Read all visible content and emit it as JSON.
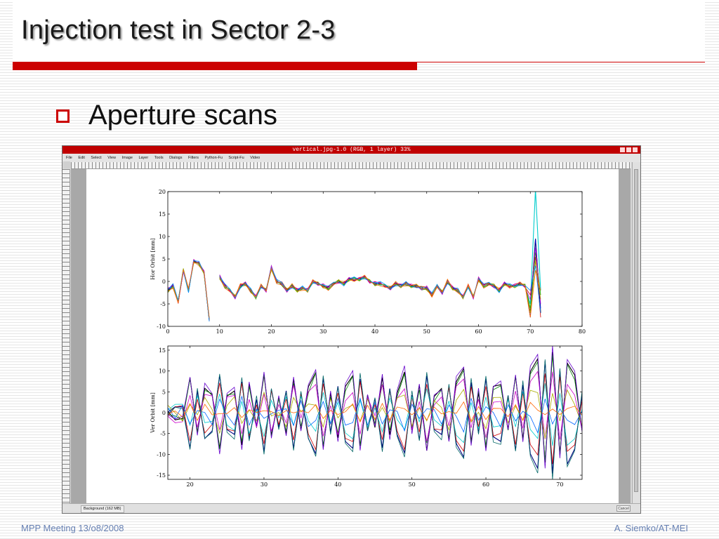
{
  "slide": {
    "title": "Injection test in Sector 2-3",
    "bullet": "Aperture scans",
    "footer_left": "MPP Meeting 13/o8/2008",
    "footer_right": "A. Siemko/AT-MEI"
  },
  "colors": {
    "accent_red": "#cc0000",
    "footer_text": "#6680b3",
    "gimp_title_bar": "#c00000"
  },
  "gimp": {
    "window_title": "vertical.jpg-1.0 (RGB, 1 layer) 33%",
    "menu": [
      "File",
      "Edit",
      "Select",
      "View",
      "Image",
      "Layer",
      "Tools",
      "Dialogs",
      "Filters",
      "Python-Fu",
      "Script-Fu",
      "Video"
    ],
    "status": "Background (162 MB)",
    "cancel": "Cancel"
  },
  "chart_data": [
    {
      "type": "line",
      "title": "",
      "xlabel": "",
      "ylabel": "Hor Orbit [mm]",
      "xlim": [
        0,
        80
      ],
      "ylim": [
        -10,
        20
      ],
      "xticks": [
        0,
        10,
        20,
        30,
        40,
        50,
        60,
        70,
        80
      ],
      "yticks": [
        -10,
        -5,
        0,
        5,
        10,
        15,
        20
      ],
      "x": [
        0,
        1,
        2,
        3,
        4,
        5,
        6,
        7,
        8,
        9,
        10,
        11,
        12,
        13,
        14,
        15,
        16,
        17,
        18,
        19,
        20,
        21,
        22,
        23,
        24,
        25,
        26,
        27,
        28,
        29,
        30,
        31,
        32,
        33,
        34,
        35,
        36,
        37,
        38,
        39,
        40,
        41,
        42,
        43,
        44,
        45,
        46,
        47,
        48,
        49,
        50,
        51,
        52,
        53,
        54,
        55,
        56,
        57,
        58,
        59,
        60,
        61,
        62,
        63,
        64,
        65,
        66,
        67,
        68,
        69,
        70,
        71,
        72
      ],
      "base_values": [
        -2,
        -1,
        -4.5,
        2.5,
        -2,
        4.5,
        4,
        2,
        -8.5,
        null,
        1,
        -1,
        -2,
        -3.5,
        -1,
        -0.5,
        -2,
        -3.5,
        -1,
        -2,
        3,
        0,
        -0.5,
        -2,
        -1,
        -2,
        -1.5,
        -2,
        0,
        -0.5,
        -1,
        -1.5,
        -0.5,
        0,
        -0.5,
        0.5,
        0.5,
        0.5,
        1,
        0,
        -0.5,
        -0.5,
        -1,
        -1.5,
        -0.5,
        -1,
        -0.5,
        -1,
        -1,
        -1.5,
        -1.5,
        -3,
        -1,
        -2.5,
        0,
        -1.5,
        -2,
        -3.5,
        -1,
        -3.5,
        0.5,
        -1,
        -0.5,
        -1,
        -2,
        -0.5,
        -1,
        -1,
        -0.5,
        -1,
        -1,
        0.5,
        0
      ],
      "series": [
        {
          "offsets": [
            0,
            0,
            0,
            0,
            0,
            0,
            0,
            0,
            0,
            0,
            0,
            0,
            0,
            0,
            0,
            0,
            0,
            0,
            0,
            0,
            0,
            0,
            0,
            0,
            0,
            0,
            0,
            0,
            0,
            0,
            0,
            0,
            0,
            0,
            0,
            0,
            0,
            0,
            0,
            0,
            0,
            0,
            0,
            0,
            0,
            0,
            0,
            0,
            0,
            0,
            0,
            0,
            0,
            0,
            0,
            0,
            0,
            0,
            0,
            0,
            0,
            0,
            0,
            0,
            0,
            0,
            0,
            0,
            0,
            0,
            -6,
            9,
            -7
          ],
          "color": "#000000"
        },
        {
          "offsets": [
            0.4,
            -0.3,
            0.2,
            0.3,
            -0.2,
            0.3,
            -0.2,
            0.2,
            0.3,
            0,
            0.4,
            -0.3,
            0.3,
            -0.3,
            0.2,
            -0.3,
            0.3,
            -0.4,
            0.3,
            -0.2,
            0.4,
            -0.3,
            0.2,
            -0.3,
            0.3,
            -0.3,
            0.3,
            -0.2,
            0.3,
            -0.3,
            0.2,
            -0.3,
            0.3,
            -0.2,
            0.3,
            -0.2,
            0.3,
            -0.3,
            0.2,
            -0.3,
            0.3,
            -0.3,
            0.2,
            -0.3,
            0.3,
            -0.2,
            0.3,
            -0.3,
            0.2,
            -0.3,
            0.3,
            -0.2,
            0.3,
            -0.3,
            0.2,
            -0.3,
            0.3,
            -0.3,
            0.2,
            -0.3,
            0.3,
            -0.2,
            0.3,
            -0.3,
            0.2,
            -0.3,
            0.3,
            -0.2,
            0.3,
            -0.3,
            -4,
            20,
            -2
          ],
          "color": "#00cccc"
        },
        {
          "offsets": [
            -0.4,
            0.3,
            -0.3,
            -0.3,
            0.3,
            -0.2,
            0.3,
            -0.3,
            -0.2,
            0,
            -0.4,
            0.3,
            -0.3,
            0.3,
            -0.2,
            0.3,
            -0.3,
            0.4,
            -0.3,
            0.3,
            -0.3,
            0.3,
            -0.3,
            0.3,
            -0.3,
            0.3,
            -0.2,
            0.3,
            -0.3,
            0.3,
            -0.2,
            0.3,
            -0.3,
            0.3,
            -0.2,
            0.3,
            -0.3,
            0.3,
            -0.2,
            0.3,
            -0.3,
            0.3,
            -0.3,
            0.2,
            -0.3,
            0.3,
            -0.3,
            0.2,
            -0.3,
            0.3,
            -0.3,
            0.2,
            -0.3,
            0.3,
            -0.3,
            0.2,
            -0.3,
            0.3,
            -0.3,
            0.2,
            -0.3,
            0.3,
            -0.3,
            0.2,
            -0.3,
            0.3,
            -0.3,
            0.2,
            -0.3,
            0.3,
            -7,
            9,
            -6
          ],
          "color": "#0000cc"
        },
        {
          "offsets": [
            0.2,
            0.4,
            -0.4,
            0.2,
            0.4,
            -0.3,
            0.2,
            0.3,
            -0.3,
            0,
            0.2,
            0.4,
            -0.3,
            0.2,
            0.4,
            -0.3,
            0.2,
            0.3,
            -0.4,
            0.2,
            0.3,
            -0.3,
            0.4,
            0.2,
            -0.3,
            0.3,
            0.2,
            -0.4,
            0.3,
            0.2,
            -0.3,
            0.4,
            0.2,
            -0.3,
            0.3,
            0.2,
            -0.4,
            0.3,
            0.2,
            -0.3,
            0.4,
            0.2,
            -0.3,
            0.3,
            0.2,
            -0.4,
            0.3,
            0.2,
            -0.3,
            0.4,
            0.2,
            -0.3,
            0.3,
            0.2,
            -0.4,
            0.3,
            0.2,
            -0.3,
            0.4,
            0.2,
            -0.3,
            0.3,
            0.2,
            -0.4,
            0.3,
            0.2,
            -0.3,
            0.4,
            0.2,
            -0.3,
            -2,
            5,
            -8
          ],
          "color": "#cc0000"
        },
        {
          "offsets": [
            -0.2,
            -0.4,
            0.4,
            -0.2,
            -0.4,
            0.3,
            -0.2,
            -0.3,
            0.3,
            0,
            -0.2,
            -0.4,
            0.3,
            -0.2,
            -0.4,
            0.3,
            -0.2,
            -0.3,
            0.4,
            -0.2,
            -0.3,
            0.3,
            -0.4,
            -0.2,
            0.3,
            -0.3,
            -0.2,
            0.4,
            -0.3,
            -0.2,
            0.3,
            -0.4,
            -0.2,
            0.3,
            -0.3,
            -0.2,
            0.4,
            -0.3,
            -0.2,
            0.3,
            -0.4,
            -0.2,
            0.3,
            -0.3,
            -0.2,
            0.4,
            -0.3,
            -0.2,
            0.3,
            -0.4,
            -0.2,
            0.3,
            -0.3,
            -0.2,
            0.4,
            -0.3,
            -0.2,
            0.3,
            -0.4,
            -0.2,
            0.3,
            -0.3,
            -0.2,
            0.4,
            -0.3,
            -0.2,
            0.3,
            -0.4,
            -0.2,
            0.3,
            -5,
            6,
            -3
          ],
          "color": "#00aa00"
        },
        {
          "offsets": [
            0.5,
            0.1,
            -0.1,
            -0.4,
            0.1,
            0.4,
            -0.1,
            0.4,
            0.1,
            0,
            0.5,
            0.1,
            -0.1,
            -0.4,
            0.1,
            0.4,
            -0.1,
            0.4,
            0.1,
            -0.4,
            0.5,
            0.1,
            -0.1,
            -0.4,
            0.1,
            0.4,
            -0.1,
            0.4,
            0.1,
            -0.4,
            0.5,
            0.1,
            -0.1,
            -0.4,
            0.1,
            0.4,
            -0.1,
            0.4,
            0.1,
            -0.4,
            0.5,
            0.1,
            -0.1,
            -0.4,
            0.1,
            0.4,
            -0.1,
            0.4,
            0.1,
            -0.4,
            0.5,
            0.1,
            -0.1,
            -0.4,
            0.1,
            0.4,
            -0.1,
            0.4,
            0.1,
            -0.4,
            0.5,
            0.1,
            -0.1,
            -0.4,
            0.1,
            0.4,
            -0.1,
            0.4,
            0.1,
            -0.4,
            -3,
            7,
            -5
          ],
          "color": "#cc00cc"
        },
        {
          "offsets": [
            -0.5,
            -0.1,
            0.1,
            0.4,
            -0.1,
            -0.4,
            0.1,
            -0.4,
            -0.1,
            0,
            -0.5,
            -0.1,
            0.1,
            0.4,
            -0.1,
            -0.4,
            0.1,
            -0.4,
            -0.1,
            0.4,
            -0.5,
            -0.1,
            0.1,
            0.4,
            -0.1,
            -0.4,
            0.1,
            -0.4,
            -0.1,
            0.4,
            -0.5,
            -0.1,
            0.1,
            0.4,
            -0.1,
            -0.4,
            0.1,
            -0.4,
            -0.1,
            0.4,
            -0.5,
            -0.1,
            0.1,
            0.4,
            -0.1,
            -0.4,
            0.1,
            -0.4,
            -0.1,
            0.4,
            -0.5,
            -0.1,
            0.1,
            0.4,
            -0.1,
            -0.4,
            0.1,
            -0.4,
            -0.1,
            0.4,
            -0.5,
            -0.1,
            0.1,
            0.4,
            -0.1,
            -0.4,
            0.1,
            -0.4,
            -0.1,
            0.4,
            -6,
            4,
            -4
          ],
          "color": "#aaaa00"
        },
        {
          "offsets": [
            0.1,
            0.5,
            0.3,
            -0.1,
            -0.5,
            0.1,
            0.5,
            -0.1,
            -0.4,
            0,
            0.1,
            0.5,
            0.3,
            -0.1,
            -0.5,
            0.1,
            0.5,
            -0.1,
            -0.4,
            0.1,
            0.1,
            0.5,
            0.3,
            -0.1,
            -0.5,
            0.1,
            0.5,
            -0.1,
            -0.4,
            0.1,
            0.1,
            0.5,
            0.3,
            -0.1,
            -0.5,
            0.1,
            0.5,
            -0.1,
            -0.4,
            0.1,
            0.1,
            0.5,
            0.3,
            -0.1,
            -0.5,
            0.1,
            0.5,
            -0.1,
            -0.4,
            0.1,
            0.1,
            0.5,
            0.3,
            -0.1,
            -0.5,
            0.1,
            0.5,
            -0.1,
            -0.4,
            0.1,
            0.1,
            0.5,
            0.3,
            -0.1,
            -0.5,
            0.1,
            0.5,
            -0.1,
            -0.4,
            0.1,
            -1,
            3,
            -7
          ],
          "color": "#0088ff"
        },
        {
          "offsets": [
            -0.1,
            -0.5,
            -0.3,
            0.1,
            0.5,
            -0.1,
            -0.5,
            0.1,
            0.4,
            0,
            -0.1,
            -0.5,
            -0.3,
            0.1,
            0.5,
            -0.1,
            -0.5,
            0.1,
            0.4,
            -0.1,
            -0.1,
            -0.5,
            -0.3,
            0.1,
            0.5,
            -0.1,
            -0.5,
            0.1,
            0.4,
            -0.1,
            -0.1,
            -0.5,
            -0.3,
            0.1,
            0.5,
            -0.1,
            -0.5,
            0.1,
            0.4,
            -0.1,
            -0.1,
            -0.5,
            -0.3,
            0.1,
            0.5,
            -0.1,
            -0.5,
            0.1,
            0.4,
            -0.1,
            -0.1,
            -0.5,
            -0.3,
            0.1,
            0.5,
            -0.1,
            -0.5,
            0.1,
            0.4,
            -0.1,
            -0.1,
            -0.5,
            -0.3,
            0.1,
            0.5,
            -0.1,
            -0.5,
            0.1,
            0.4,
            -0.1,
            -7,
            2,
            -2
          ],
          "color": "#ff6600"
        }
      ]
    },
    {
      "type": "line",
      "title": "",
      "xlabel": "",
      "ylabel": "Ver Orbit [mm]",
      "xlim": [
        17,
        73
      ],
      "ylim": [
        -16,
        16
      ],
      "xticks": [
        20,
        30,
        40,
        50,
        60,
        70
      ],
      "yticks": [
        -15,
        -10,
        -5,
        0,
        5,
        10,
        15
      ],
      "x": [
        17,
        18,
        19,
        20,
        21,
        22,
        23,
        24,
        25,
        26,
        27,
        28,
        29,
        30,
        31,
        32,
        33,
        34,
        35,
        36,
        37,
        38,
        39,
        40,
        41,
        42,
        43,
        44,
        45,
        46,
        47,
        48,
        49,
        50,
        51,
        52,
        53,
        54,
        55,
        56,
        57,
        58,
        59,
        60,
        61,
        62,
        63,
        64,
        65,
        66,
        67,
        68,
        69,
        70,
        71,
        72,
        73
      ],
      "pattern": [
        0,
        -0.15,
        -0.1,
        0.75,
        -0.45,
        0.55,
        0.4,
        -0.8,
        0.35,
        0.5,
        -0.7,
        0.6,
        -0.3,
        0.85,
        -0.5,
        0.3,
        -0.45,
        0.75,
        -0.4,
        0.55,
        0.9,
        -0.75,
        0.4,
        -0.55,
        0.6,
        0.8,
        -0.75,
        0.4,
        -0.3,
        0.75,
        -0.5,
        0.45,
        0.9,
        -0.4,
        0.6,
        -0.8,
        0.35,
        0.5,
        -0.6,
        0.7,
        0.95,
        -0.65,
        0.45,
        -0.75,
        0.55,
        0.6,
        -0.35,
        0.8,
        -0.6,
        0.9,
        1.2,
        -1.1,
        1.3,
        -0.9,
        1.1,
        0.8,
        -0.4
      ],
      "series": [
        {
          "amp": 11,
          "jitter": 0.3,
          "color": "#000000"
        },
        {
          "amp": -11,
          "jitter": 0.3,
          "color": "#000080"
        },
        {
          "amp": 10,
          "jitter": 0.8,
          "color": "#008000"
        },
        {
          "amp": -9,
          "jitter": 0.8,
          "color": "#cc0000"
        },
        {
          "amp": 7,
          "jitter": 1.5,
          "color": "#cc00cc"
        },
        {
          "amp": -6,
          "jitter": 1.5,
          "color": "#00cccc"
        },
        {
          "amp": 4,
          "jitter": 1.8,
          "color": "#aaaa00"
        },
        {
          "amp": -3,
          "jitter": 1.8,
          "color": "#0066ff"
        },
        {
          "amp": 1.5,
          "jitter": 1.2,
          "color": "#ff6600"
        },
        {
          "amp": 12,
          "jitter": 0.5,
          "color": "#6600cc"
        },
        {
          "amp": -12,
          "jitter": 0.5,
          "color": "#006666"
        }
      ]
    }
  ]
}
